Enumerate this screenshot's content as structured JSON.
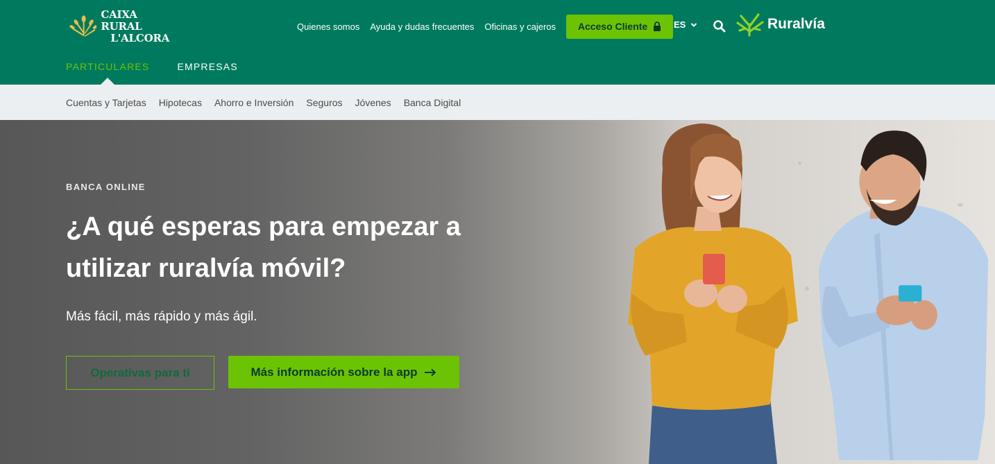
{
  "brand": {
    "name_line1": "CAIXA RURAL",
    "name_line2": "L'ALCORA",
    "logo_icon": "wheat-sheaf-icon"
  },
  "header": {
    "links": [
      "Quienes somos",
      "Ayuda y dudas frecuentes",
      "Oficinas y cajeros"
    ],
    "acceso_label": "Acceso Cliente",
    "language": "ES",
    "ruralvia_label": "Ruralvía"
  },
  "segments": {
    "tabs": [
      "PARTICULARES",
      "EMPRESAS"
    ],
    "active": "PARTICULARES"
  },
  "subnav": {
    "items": [
      "Cuentas y Tarjetas",
      "Hipotecas",
      "Ahorro e Inversión",
      "Seguros",
      "Jóvenes",
      "Banca Digital"
    ]
  },
  "hero": {
    "eyebrow": "BANCA ONLINE",
    "title": "¿A qué esperas para empezar a utilizar ruralvía móvil?",
    "subtitle": "Más fácil, más rápido y más ágil.",
    "primary_button": "Operativas para ti",
    "secondary_button": "Más información sobre la app"
  },
  "colors": {
    "header_green": "#007a5e",
    "accent_green": "#6cc304",
    "subnav_bg": "#eceff1"
  }
}
